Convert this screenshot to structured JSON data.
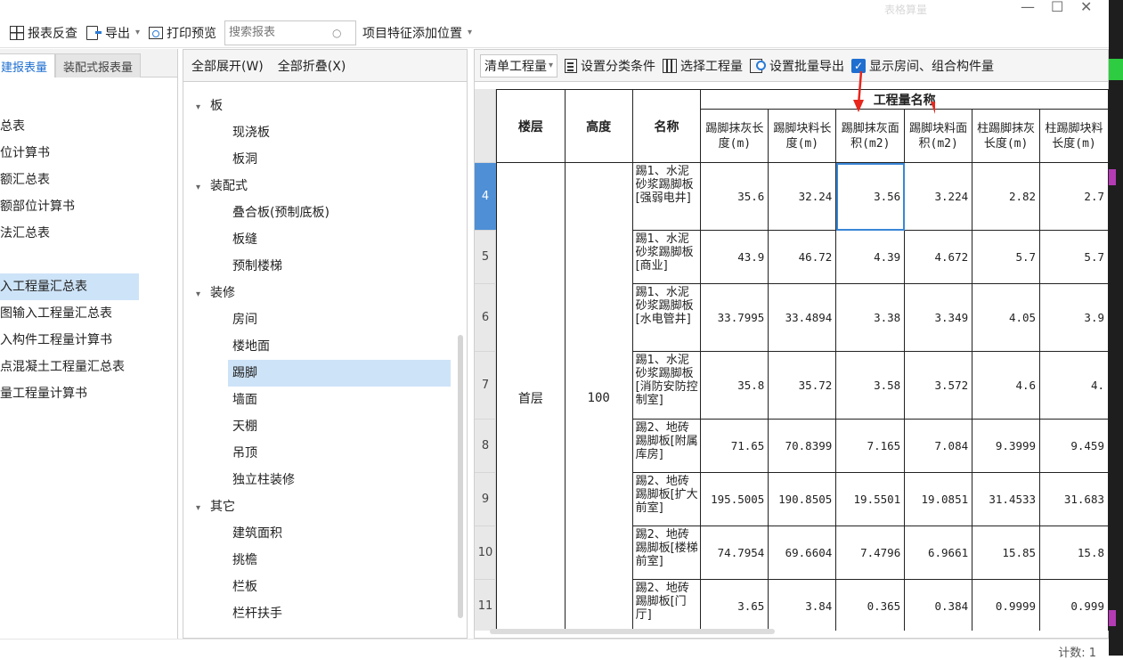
{
  "titlebar": {
    "faint_text": "表格算量",
    "minimize": "—",
    "maximize": "☐",
    "close": "✕"
  },
  "toolbar": {
    "report_check": "报表反查",
    "export": "导出",
    "print_preview": "打印预览",
    "search_placeholder": "搜索报表",
    "position": "项目特征添加位置"
  },
  "left": {
    "tabs": [
      "建报表量",
      "装配式报表量"
    ],
    "items_top": [
      "总表",
      "位计算书",
      "额汇总表",
      "额部位计算书",
      "法汇总表"
    ],
    "items_bottom": [
      "入工程量汇总表",
      "图输入工程量汇总表",
      "入构件工程量计算书",
      "点混凝土工程量汇总表",
      "量工程量计算书"
    ]
  },
  "middle": {
    "expand_all": "全部展开(W)",
    "collapse_all": "全部折叠(X)",
    "tree": [
      {
        "label": "板",
        "level": 0
      },
      {
        "label": "现浇板",
        "level": 1
      },
      {
        "label": "板洞",
        "level": 1
      },
      {
        "label": "装配式",
        "level": 0
      },
      {
        "label": "叠合板(预制底板)",
        "level": 1
      },
      {
        "label": "板缝",
        "level": 1
      },
      {
        "label": "预制楼梯",
        "level": 1
      },
      {
        "label": "装修",
        "level": 0
      },
      {
        "label": "房间",
        "level": 1
      },
      {
        "label": "楼地面",
        "level": 1
      },
      {
        "label": "踢脚",
        "level": 1,
        "selected": true
      },
      {
        "label": "墙面",
        "level": 1
      },
      {
        "label": "天棚",
        "level": 1
      },
      {
        "label": "吊顶",
        "level": 1
      },
      {
        "label": "独立柱装修",
        "level": 1
      },
      {
        "label": "其它",
        "level": 0
      },
      {
        "label": "建筑面积",
        "level": 1
      },
      {
        "label": "挑檐",
        "level": 1
      },
      {
        "label": "栏板",
        "level": 1
      },
      {
        "label": "栏杆扶手",
        "level": 1
      }
    ]
  },
  "right": {
    "toolbar": {
      "mode": "清单工程量",
      "set_category": "设置分类条件",
      "select_qty": "选择工程量",
      "batch_export": "设置批量导出",
      "show_room": "显示房间、组合构件量"
    },
    "table": {
      "headers": {
        "floor": "楼层",
        "height": "高度",
        "name": "名称",
        "group": "工程量名称"
      },
      "subheaders": [
        "踢脚抹灰长度(m)",
        "踢脚块料长度(m)",
        "踢脚抹灰面积(m2)",
        "踢脚块料面积(m2)",
        "柱踢脚抹灰长度(m)",
        "柱踢脚块料长度(m)"
      ],
      "floor": "首层",
      "height": "100",
      "rows": [
        {
          "num": "4",
          "name": "踢1、水泥砂浆踢脚板[强弱电井]",
          "v": [
            "35.6",
            "32.24",
            "3.56",
            "3.224",
            "2.82",
            "2.7"
          ]
        },
        {
          "num": "5",
          "name": "踢1、水泥砂浆踢脚板[商业]",
          "v": [
            "43.9",
            "46.72",
            "4.39",
            "4.672",
            "5.7",
            "5.7"
          ]
        },
        {
          "num": "6",
          "name": "踢1、水泥砂浆踢脚板[水电管井]",
          "v": [
            "33.7995",
            "33.4894",
            "3.38",
            "3.349",
            "4.05",
            "3.9"
          ]
        },
        {
          "num": "7",
          "name": "踢1、水泥砂浆踢脚板[消防安防控制室]",
          "v": [
            "35.8",
            "35.72",
            "3.58",
            "3.572",
            "4.6",
            "4."
          ]
        },
        {
          "num": "8",
          "name": "踢2、地砖踢脚板[附属库房]",
          "v": [
            "71.65",
            "70.8399",
            "7.165",
            "7.084",
            "9.3999",
            "9.459"
          ]
        },
        {
          "num": "9",
          "name": "踢2、地砖踢脚板[扩大前室]",
          "v": [
            "195.5005",
            "190.8505",
            "19.5501",
            "19.0851",
            "31.4533",
            "31.683"
          ]
        },
        {
          "num": "10",
          "name": "踢2、地砖踢脚板[楼梯前室]",
          "v": [
            "74.7954",
            "69.6604",
            "7.4796",
            "6.9661",
            "15.85",
            "15.8"
          ]
        },
        {
          "num": "11",
          "name": "踢2、地砖踢脚板[门厅]",
          "v": [
            "3.65",
            "3.84",
            "0.365",
            "0.384",
            "0.9999",
            "0.999"
          ]
        }
      ]
    }
  },
  "status": {
    "count": "计数: 1"
  },
  "colors": {
    "accent": "#1f6fd0",
    "selection": "#cde3f7",
    "annotation": "#e8261c"
  }
}
